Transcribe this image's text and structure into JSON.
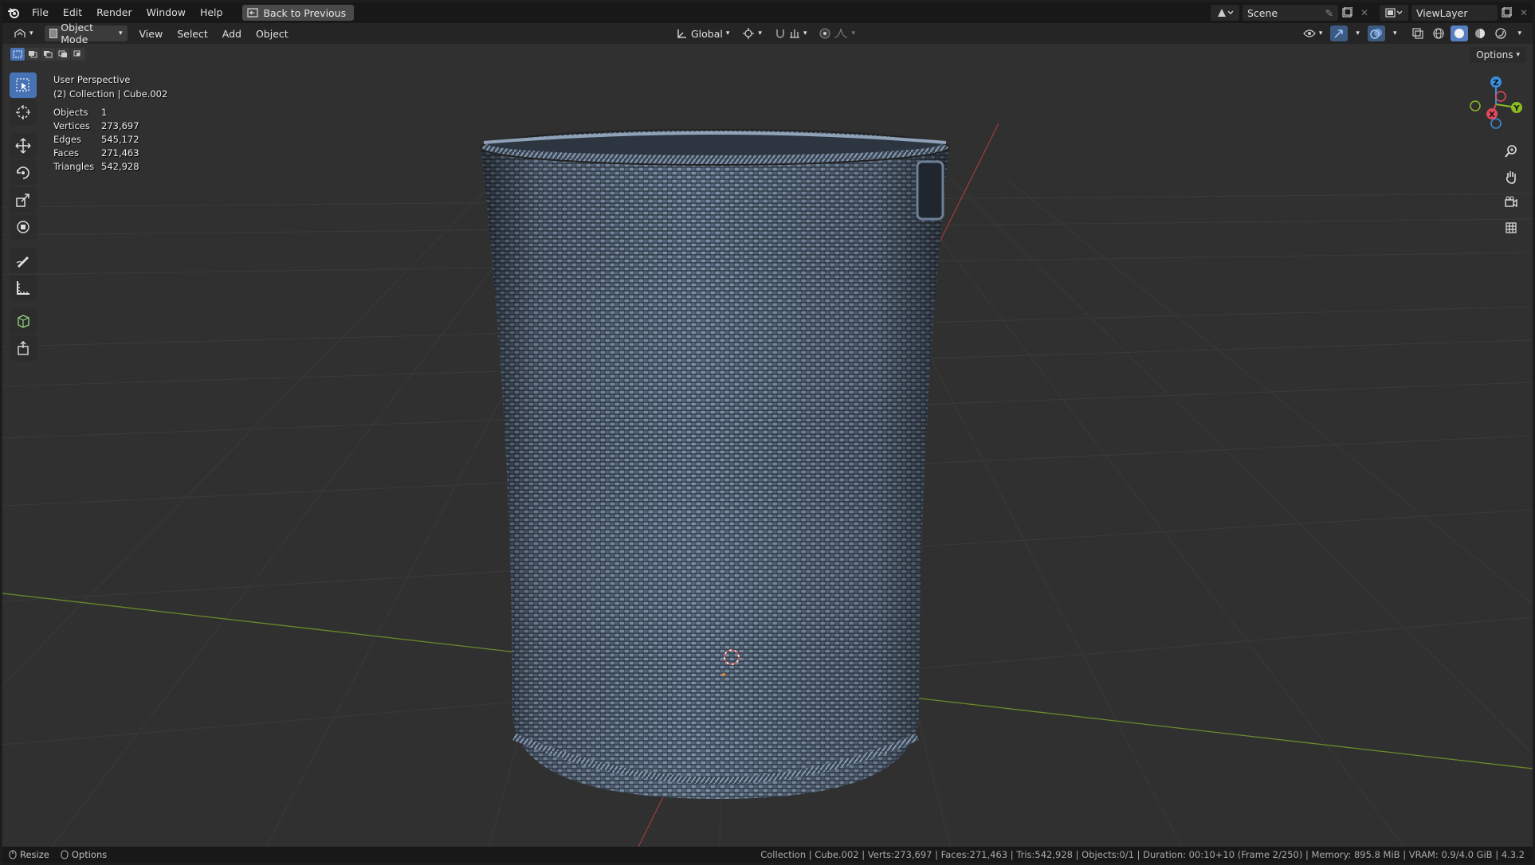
{
  "topbar": {
    "menus": [
      "File",
      "Edit",
      "Render",
      "Window",
      "Help"
    ],
    "back_label": "Back to Previous",
    "scene_name": "Scene",
    "view_layer": "ViewLayer"
  },
  "header": {
    "mode_label": "Object Mode",
    "menus": [
      "View",
      "Select",
      "Add",
      "Object"
    ],
    "transform_orientation": "Global"
  },
  "options_label": "Options",
  "overlay": {
    "view_name": "User Perspective",
    "collection_info": "(2) Collection | Cube.002",
    "stats": [
      {
        "label": "Objects",
        "value": "1"
      },
      {
        "label": "Vertices",
        "value": "273,697"
      },
      {
        "label": "Edges",
        "value": "545,172"
      },
      {
        "label": "Faces",
        "value": "271,463"
      },
      {
        "label": "Triangles",
        "value": "542,928"
      }
    ]
  },
  "gizmo": {
    "x": "X",
    "y": "Y",
    "z": "Z"
  },
  "statusbar": {
    "resize": "Resize",
    "options": "Options",
    "info": "Collection | Cube.002 | Verts:273,697 | Faces:271,463 | Tris:542,928 | Objects:0/1 | Duration: 00:10+10 (Frame 2/250) | Memory: 895.8 MiB | VRAM: 0.9/4.0 GiB | 4.3.2"
  },
  "colors": {
    "accent": "#4772b3",
    "mesh": "#5d6d80",
    "x_axis": "#e04a5a",
    "y_axis": "#8bbb22",
    "z_axis": "#3a8fe0"
  }
}
